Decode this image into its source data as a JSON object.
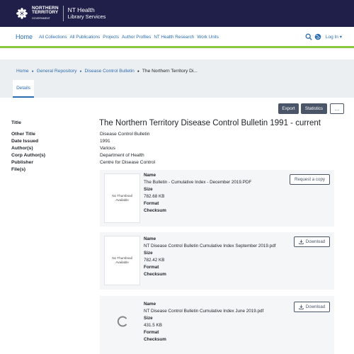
{
  "header": {
    "logo_line1": "NORTHERN",
    "logo_line2": "TERRITORY",
    "logo_line3": "GOVERNMENT",
    "brand_line1": "NT Health",
    "brand_line2": "Library Services"
  },
  "nav": {
    "home": "Home",
    "links": [
      "All Collections",
      "All Publications",
      "Projects",
      "Author Profiles",
      "NT Health Research",
      "Work Units"
    ],
    "login": "Log In",
    "accent": "#8cc63f",
    "link_color": "#2b6cb0"
  },
  "breadcrumb": [
    "Home",
    "General Repository",
    "Disease Control Bulletin",
    "The Northern Territory Di..."
  ],
  "tabs": {
    "details": "Details"
  },
  "actions": {
    "export": "Export",
    "statistics": "Statistics",
    "more": "..."
  },
  "item": {
    "labels": {
      "title": "Title",
      "other_title": "Other Title",
      "date_issued": "Date Issued",
      "authors": "Author(s)",
      "corp_authors": "Corp Author(s)",
      "publisher": "Publisher",
      "files": "File(s)"
    },
    "title": "The Northern Territory Disease Control Bulletin 1991 - current",
    "other_title": "Disease Control Bulletin",
    "date_issued": "1991",
    "authors": "Various",
    "corp_authors": "Department of Health",
    "publisher": "Centre for Disease Control"
  },
  "files": [
    {
      "thumbnail_text": "No Thumbnail Available",
      "name_label": "Name",
      "name": "The Bulletin - Cumulative Index - December 2019.PDF",
      "size_label": "Size",
      "size": "782.68 KB",
      "format_label": "Format",
      "checksum_label": "Checksum",
      "button": "Request a copy"
    },
    {
      "thumbnail_text": "No Thumbnail Available",
      "name_label": "Name",
      "name": "NT Disease Control Bulletin Cumulative Index September 2019.pdf",
      "size_label": "Size",
      "size": "782.42 KB",
      "format_label": "Format",
      "checksum_label": "Checksum",
      "button": "Download"
    },
    {
      "thumbnail_text": "",
      "name_label": "Name",
      "name": "NT Disease Control Bulletin Cumulative Index June 2019.pdf",
      "size_label": "Size",
      "size": "431.5 KB",
      "format_label": "Format",
      "checksum_label": "Checksum",
      "button": "Download"
    }
  ]
}
